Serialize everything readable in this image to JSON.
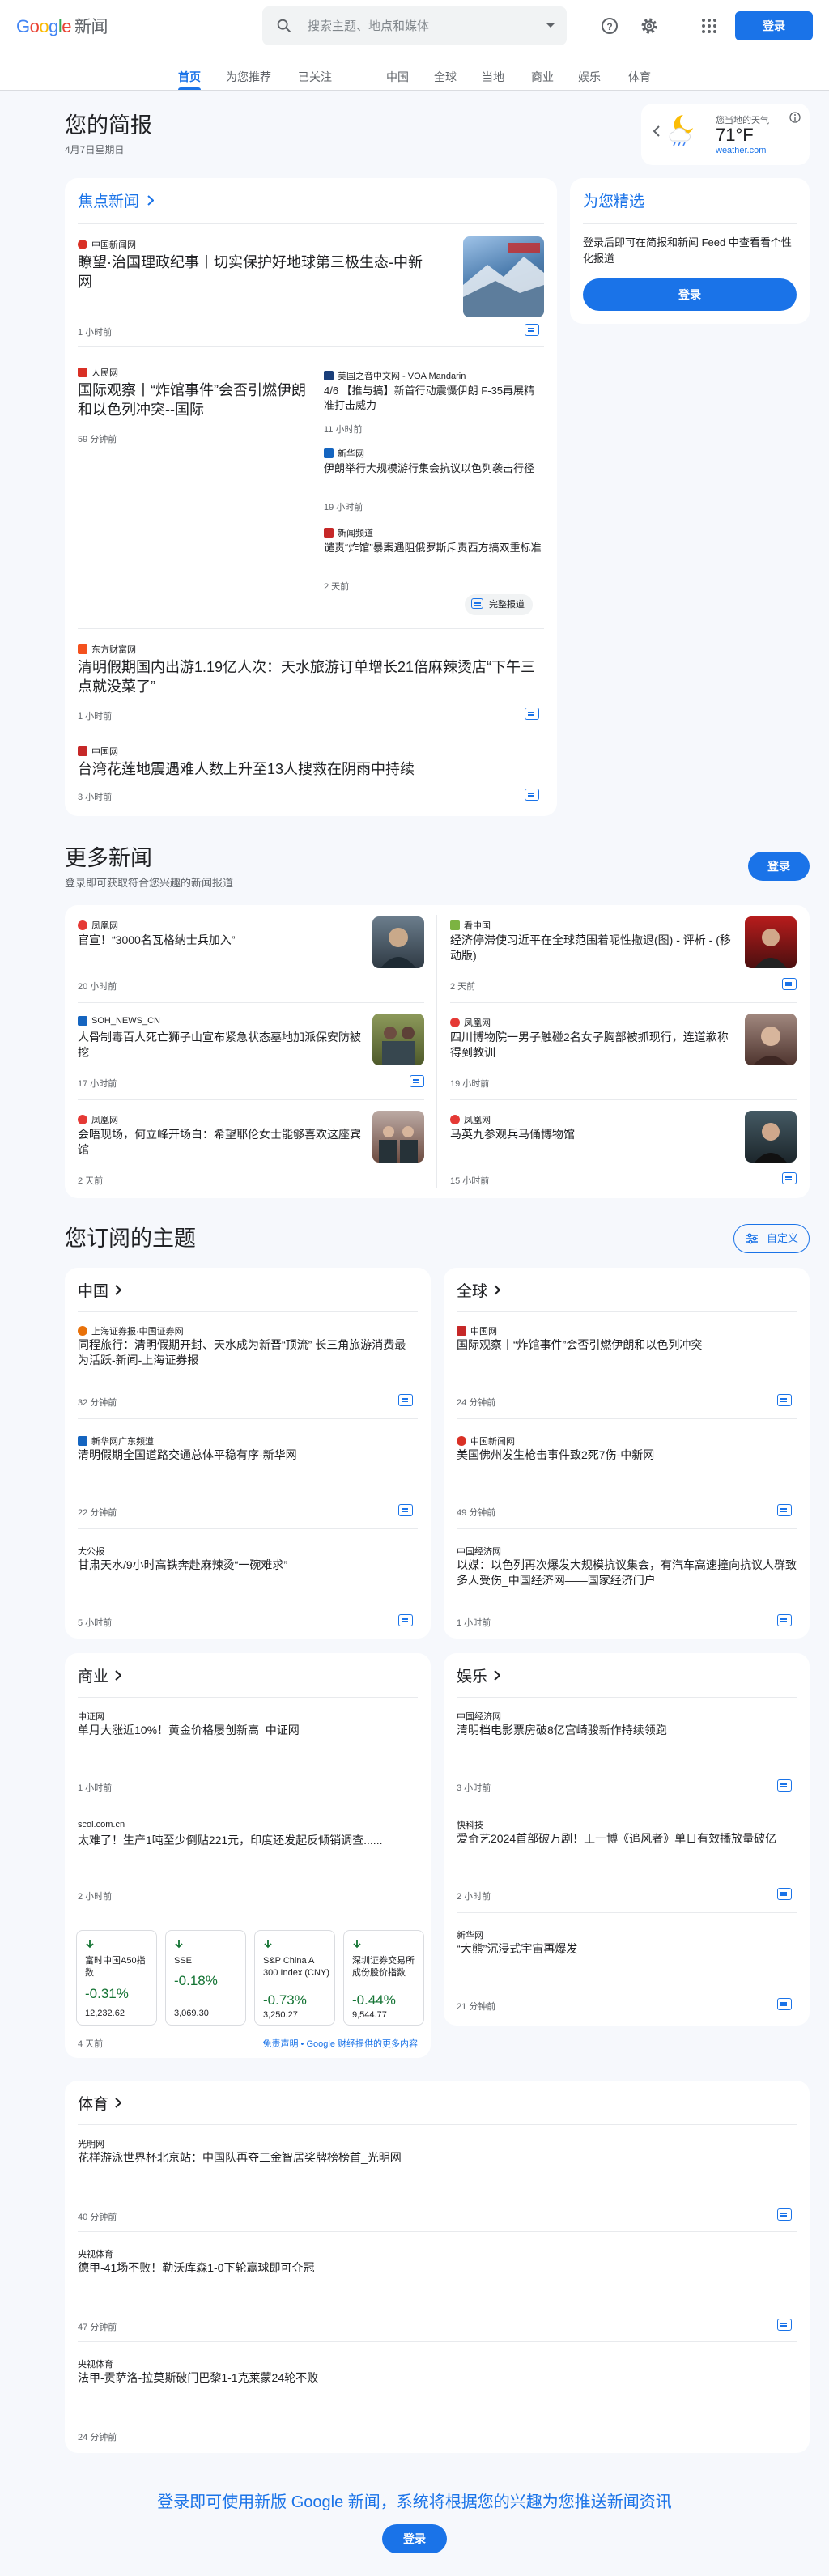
{
  "header": {
    "logo": "Google",
    "logo_suffix": "新闻",
    "search_placeholder": "搜索主题、地点和媒体",
    "signin": "登录",
    "icons": [
      "search-icon",
      "chevron-down-icon",
      "help-icon",
      "gear-icon",
      "apps-icon"
    ]
  },
  "tabs": [
    "首页",
    "为您推荐",
    "已关注",
    "中国",
    "全球",
    "当地",
    "商业",
    "娱乐",
    "体育"
  ],
  "briefing": {
    "title": "您的简报",
    "date": "4月7日星期日"
  },
  "weather": {
    "label": "您当地的天气",
    "temp": "71°F",
    "source": "weather.com"
  },
  "headlines": {
    "title": "焦点新闻",
    "story1": {
      "source": "中国新闻网",
      "title": "瞭望·治国理政纪事丨切实保护好地球第三极生态-中新网",
      "time": "1 小时前"
    },
    "story2": {
      "main": {
        "source": "人民网",
        "title": "国际观察丨“炸馆事件”会否引燃伊朗和以色列冲突--国际",
        "time": "59 分钟前"
      },
      "related": [
        {
          "source": "美国之音中文网 - VOA Mandarin",
          "title": "4/6 【推与搞】新首行动震慑伊朗 F-35再展精准打击威力",
          "time": "11 小时前"
        },
        {
          "source": "新华网",
          "title": "伊朗举行大规模游行集会抗议以色列袭击行径",
          "time": "19 小时前"
        },
        {
          "source": "新闻频道",
          "title": "谴责“炸馆”暴案遇阻俄罗斯斥责西方搞双重标准",
          "time": "2 天前"
        }
      ],
      "full_coverage": "完整报道"
    },
    "story3": {
      "source": "东方财富网",
      "title": "清明假期国内出游1.19亿人次：天水旅游订单增长21倍麻辣烫店“下午三点就没菜了”",
      "time": "1 小时前"
    },
    "story4": {
      "source": "中国网",
      "title": "台湾花莲地震遇难人数上升至13人搜救在阴雨中持续",
      "time": "3 小时前"
    }
  },
  "picks": {
    "title": "为您精选",
    "text": "登录后即可在简报和新闻 Feed 中查看看个性化报道",
    "button": "登录"
  },
  "more": {
    "title": "更多新闻",
    "subtitle": "登录即可获取符合您兴趣的新闻报道",
    "button": "登录",
    "items": [
      {
        "source": "凤凰网",
        "title": "官宣！“3000名瓦格纳士兵加入”",
        "time": "20 小时前"
      },
      {
        "source": "看中国",
        "title": "经济停滞使习近平在全球范围着呢性撤退(图) - 评析 - (移动版)",
        "time": "2 天前"
      },
      {
        "source": "SOH_NEWS_CN",
        "title": "人骨制毒百人死亡狮子山宣布紧急状态墓地加派保安防被挖",
        "time": "17 小时前"
      },
      {
        "source": "凤凰网",
        "title": "四川博物院一男子触碰2名女子胸部被抓现行，连道歉称得到教训",
        "time": "19 小时前"
      },
      {
        "source": "凤凰网",
        "title": "会晤现场，何立峰开场白：希望耶伦女士能够喜欢这座宾馆",
        "time": "2 天前"
      },
      {
        "source": "凤凰网",
        "title": "马英九参观兵马俑博物馆",
        "time": "15 小时前"
      }
    ]
  },
  "topics": {
    "title": "您订阅的主题",
    "customize": "自定义",
    "china": {
      "title": "中国",
      "items": [
        {
          "source": "上海证券报·中国证券网",
          "title": "同程旅行：清明假期开封、天水成为新晋“顶流” 长三角旅游消费最为活跃-新闻-上海证券报",
          "time": "32 分钟前"
        },
        {
          "source": "新华网广东频道",
          "title": "清明假期全国道路交通总体平稳有序-新华网",
          "time": "22 分钟前"
        },
        {
          "source": "大公报",
          "title": "甘肃天水/9小时高铁奔赴麻辣烫“一碗难求”",
          "time": "5 小时前"
        }
      ]
    },
    "world": {
      "title": "全球",
      "items": [
        {
          "source": "中国网",
          "title": "国际观察丨“炸馆事件”会否引燃伊朗和以色列冲突",
          "time": "24 分钟前"
        },
        {
          "source": "中国新闻网",
          "title": "美国佛州发生枪击事件致2死7伤-中新网",
          "time": "49 分钟前"
        },
        {
          "source": "中国经济网",
          "title": "以媒：以色列再次爆发大规模抗议集会，有汽车高速撞向抗议人群致多人受伤_中国经济网——国家经济门户",
          "time": "1 小时前"
        }
      ]
    },
    "business": {
      "title": "商业",
      "items": [
        {
          "source": "中证网",
          "title": "单月大涨近10%！黄金价格屡创新高_中证网",
          "time": "1 小时前"
        },
        {
          "source": "scol.com.cn",
          "title": "太难了！生产1吨至少倒贴221元，印度还发起反倾销调查......",
          "time": "2 小时前"
        }
      ],
      "stocks": [
        {
          "name": "富时中国A50指数",
          "change": "-0.31%",
          "value": "12,232.62"
        },
        {
          "name": "SSE",
          "change": "-0.18%",
          "value": "3,069.30"
        },
        {
          "name": "S&P China A 300 Index (CNY)",
          "change": "-0.73%",
          "value": "3,250.27"
        },
        {
          "name": "深圳证券交易所成份股价指数",
          "change": "-0.44%",
          "value": "9,544.77"
        }
      ],
      "time": "4 天前",
      "disclaimer": "免责声明 • Google 财经提供的更多内容"
    },
    "ent": {
      "title": "娱乐",
      "items": [
        {
          "source": "中国经济网",
          "title": "清明档电影票房破8亿宫崎骏新作持续领跑",
          "time": "3 小时前"
        },
        {
          "source": "快科技",
          "title": "爱奇艺2024首部破万剧！王一博《追风者》单日有效播放量破亿",
          "time": "2 小时前"
        },
        {
          "source": "新华网",
          "title": "“大熊”沉浸式宇宙再爆发",
          "time": "21 分钟前"
        }
      ]
    },
    "sports": {
      "title": "体育",
      "items": [
        {
          "source": "光明网",
          "title": "花样游泳世界杯北京站：中国队再夺三金智居奖牌榜榜首_光明网",
          "time": "40 分钟前"
        },
        {
          "source": "央视体育",
          "title": "德甲-41场不败！勒沃库森1-0下轮赢球即可夺冠",
          "time": "47 分钟前"
        },
        {
          "source": "央视体育",
          "title": "法甲-贡萨洛-拉莫斯破门巴黎1-1克莱蒙24轮不败",
          "time": "24 分钟前"
        }
      ]
    }
  },
  "footer": {
    "text": "登录即可使用新版 Google 新闻，系统将根据您的兴趣为您推送新闻资讯",
    "button": "登录"
  },
  "colors": {
    "accent": "#1a73e8",
    "down": "#137333",
    "link": "#1a0dab"
  }
}
